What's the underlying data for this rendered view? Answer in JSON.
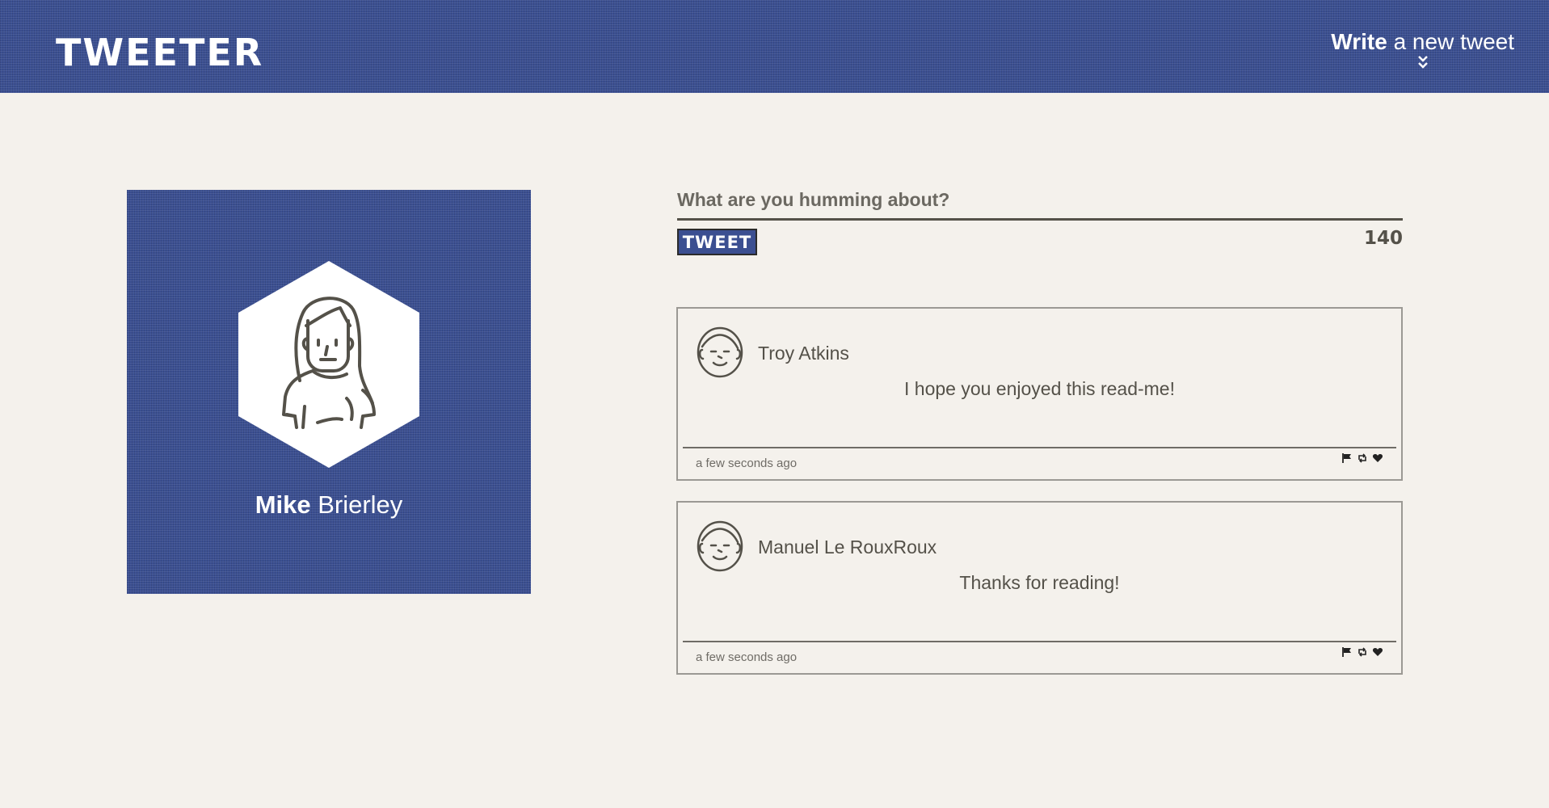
{
  "nav": {
    "brand": "TWEETER",
    "compose_strong": "Write",
    "compose_rest": " a new tweet",
    "compose_icon": "double-chevron-down-icon"
  },
  "profile": {
    "first_name": "Mike",
    "last_name": " Brierley",
    "avatar_icon": "woman-avatar-icon"
  },
  "composer": {
    "placeholder": "What are you humming about?",
    "button_label": "TWEET",
    "counter": "140"
  },
  "tweets": [
    {
      "author": "Troy Atkins",
      "text": "I hope you enjoyed this read-me!",
      "time": "a few seconds ago",
      "avatar_icon": "man-face-icon"
    },
    {
      "author": "Manuel Le RouxRoux",
      "text": "Thanks for reading!",
      "time": "a few seconds ago",
      "avatar_icon": "man-face-icon"
    }
  ],
  "colors": {
    "brand_blue": "#3b4f91",
    "background": "#f4f1ec",
    "text": "#545149"
  }
}
